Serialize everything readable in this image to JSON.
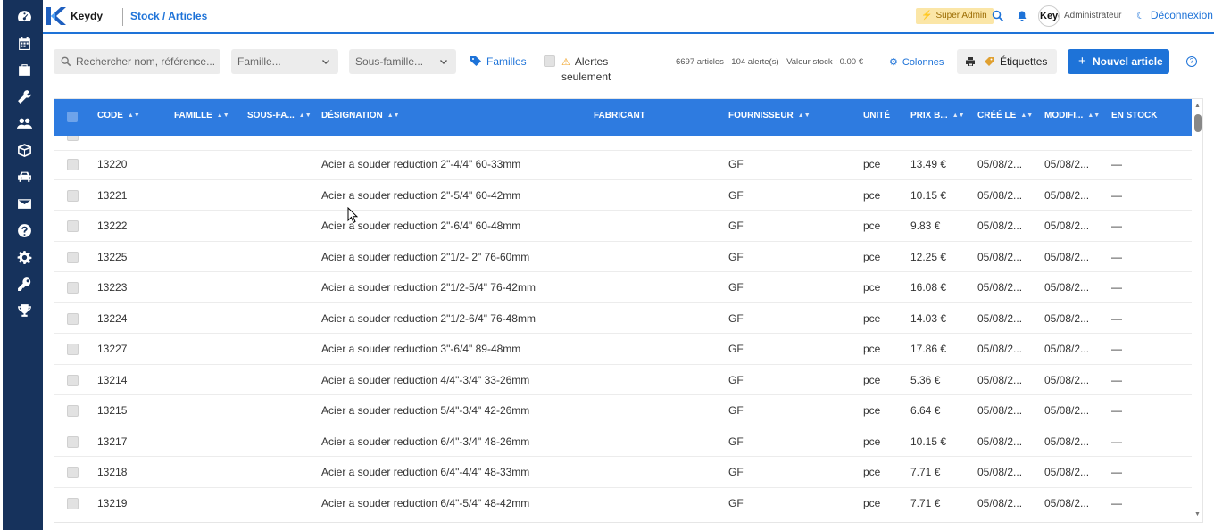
{
  "app": {
    "brand": "Keydy",
    "breadcrumb": "Stock / Articles"
  },
  "header": {
    "role_badge": "Super Admin",
    "avatar_text": "Keydy",
    "user_name": "Administrateur",
    "logout_label": "Déconnexion"
  },
  "sidebar": {
    "items": [
      "dashboard-icon",
      "calendar-icon",
      "briefcase-icon",
      "wrench-icon",
      "users-icon",
      "box-icon",
      "car-icon",
      "envelope-icon",
      "help-icon",
      "settings-icon",
      "key-icon",
      "trophy-icon"
    ]
  },
  "toolbar": {
    "search_placeholder": "Rechercher nom, référence...",
    "famille_select": "Famille...",
    "sous_famille_select": "Sous-famille...",
    "familles_link": "Familles",
    "alerts_label_line1": "Alertes",
    "alerts_label_line2": "seulement",
    "stats": "6697 articles · 104 alerte(s) · Valeur stock : 0.00 €",
    "columns_label": "Colonnes",
    "labels_button": "Étiquettes",
    "new_article_button": "Nouvel article"
  },
  "table": {
    "columns": [
      "CODE",
      "FAMILLE",
      "SOUS-FA...",
      "DÉSIGNATION",
      "FABRICANT",
      "FOURNISSEUR",
      "UNITÉ",
      "PRIX B...",
      "CRÉÉ LE",
      "MODIFI...",
      "EN STOCK"
    ],
    "rows": [
      {
        "code": "13220",
        "designation": "Acier a souder reduction 2\"-4/4\" 60-33mm",
        "fournisseur": "GF",
        "unite": "pce",
        "prix": "13.49 €",
        "cree": "05/08/2...",
        "modifie": "05/08/2...",
        "stock": "—"
      },
      {
        "code": "13221",
        "designation": "Acier a souder reduction 2\"-5/4\" 60-42mm",
        "fournisseur": "GF",
        "unite": "pce",
        "prix": "10.15 €",
        "cree": "05/08/2...",
        "modifie": "05/08/2...",
        "stock": "—"
      },
      {
        "code": "13222",
        "designation": "Acier a souder reduction 2\"-6/4\" 60-48mm",
        "fournisseur": "GF",
        "unite": "pce",
        "prix": "9.83 €",
        "cree": "05/08/2...",
        "modifie": "05/08/2...",
        "stock": "—"
      },
      {
        "code": "13225",
        "designation": "Acier a souder reduction 2\"1/2- 2\" 76-60mm",
        "fournisseur": "GF",
        "unite": "pce",
        "prix": "12.25 €",
        "cree": "05/08/2...",
        "modifie": "05/08/2...",
        "stock": "—"
      },
      {
        "code": "13223",
        "designation": "Acier a souder reduction 2\"1/2-5/4\" 76-42mm",
        "fournisseur": "GF",
        "unite": "pce",
        "prix": "16.08 €",
        "cree": "05/08/2...",
        "modifie": "05/08/2...",
        "stock": "—"
      },
      {
        "code": "13224",
        "designation": "Acier a souder reduction 2\"1/2-6/4\" 76-48mm",
        "fournisseur": "GF",
        "unite": "pce",
        "prix": "14.03 €",
        "cree": "05/08/2...",
        "modifie": "05/08/2...",
        "stock": "—"
      },
      {
        "code": "13227",
        "designation": "Acier a souder reduction 3\"-6/4\" 89-48mm",
        "fournisseur": "GF",
        "unite": "pce",
        "prix": "17.86 €",
        "cree": "05/08/2...",
        "modifie": "05/08/2...",
        "stock": "—"
      },
      {
        "code": "13214",
        "designation": "Acier a souder reduction 4/4\"-3/4\" 33-26mm",
        "fournisseur": "GF",
        "unite": "pce",
        "prix": "5.36 €",
        "cree": "05/08/2...",
        "modifie": "05/08/2...",
        "stock": "—"
      },
      {
        "code": "13215",
        "designation": "Acier a souder reduction 5/4\"-3/4\" 42-26mm",
        "fournisseur": "GF",
        "unite": "pce",
        "prix": "6.64 €",
        "cree": "05/08/2...",
        "modifie": "05/08/2...",
        "stock": "—"
      },
      {
        "code": "13217",
        "designation": "Acier a souder reduction 6/4\"-3/4\" 48-26mm",
        "fournisseur": "GF",
        "unite": "pce",
        "prix": "10.15 €",
        "cree": "05/08/2...",
        "modifie": "05/08/2...",
        "stock": "—"
      },
      {
        "code": "13218",
        "designation": "Acier a souder reduction 6/4\"-4/4\" 48-33mm",
        "fournisseur": "GF",
        "unite": "pce",
        "prix": "7.71 €",
        "cree": "05/08/2...",
        "modifie": "05/08/2...",
        "stock": "—"
      },
      {
        "code": "13219",
        "designation": "Acier a souder reduction 6/4\"-5/4\" 48-42mm",
        "fournisseur": "GF",
        "unite": "pce",
        "prix": "7.71 €",
        "cree": "05/08/2...",
        "modifie": "05/08/2...",
        "stock": "—"
      }
    ]
  },
  "colors": {
    "primary": "#1e73d8",
    "header_row": "#2e7be0",
    "sidebar": "#16325c",
    "badge": "#fbe6a7"
  }
}
